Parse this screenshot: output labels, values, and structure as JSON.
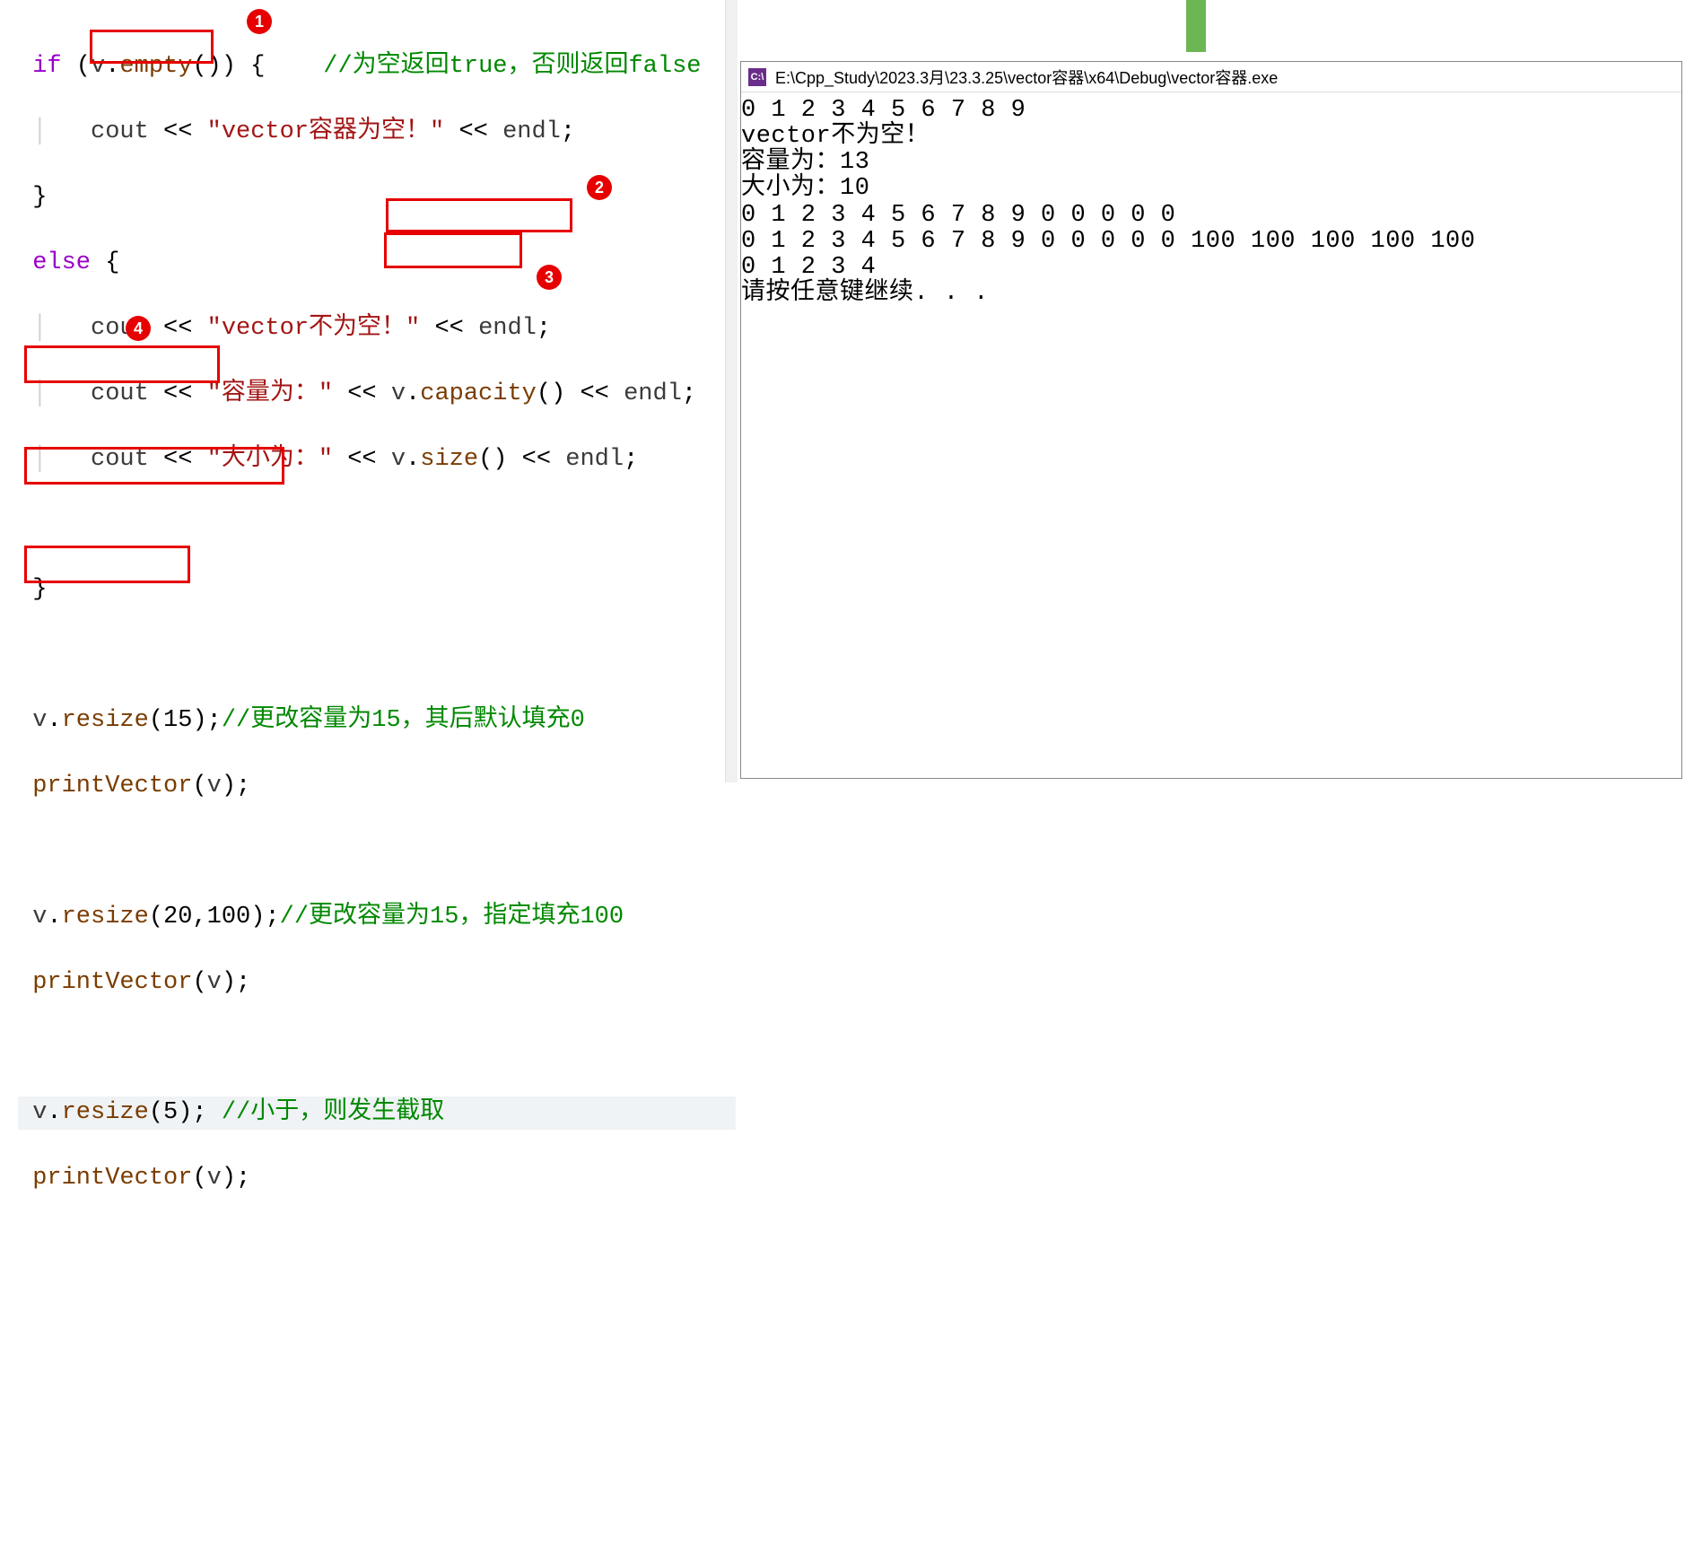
{
  "code": {
    "if": "if",
    "else": "else",
    "v": "v",
    "empty": "empty",
    "capacity": "capacity",
    "size": "size",
    "resize": "resize",
    "cout": "cout",
    "endl": "endl",
    "printVector": "printVector",
    "str_empty": "\"vector容器为空！\"",
    "str_notempty": "\"vector不为空！\"",
    "str_cap": "\"容量为：\"",
    "str_size": "\"大小为：\"",
    "cmt_empty": "//为空返回true，否则返回false",
    "cmt_r1": "//更改容量为15，其后默认填充0",
    "cmt_r2": "//更改容量为15，指定填充100",
    "cmt_r3": "//小于，则发生截取",
    "num15": "15",
    "num20": "20",
    "num100": "100",
    "num5": "5"
  },
  "badges": {
    "b1": "1",
    "b2": "2",
    "b3": "3",
    "b4": "4"
  },
  "console": {
    "title": "E:\\Cpp_Study\\2023.3月\\23.3.25\\vector容器\\x64\\Debug\\vector容器.exe",
    "icon": "C:\\",
    "lines": [
      "0 1 2 3 4 5 6 7 8 9",
      "vector不为空！",
      "容量为：13",
      "大小为：10",
      "0 1 2 3 4 5 6 7 8 9 0 0 0 0 0",
      "0 1 2 3 4 5 6 7 8 9 0 0 0 0 0 100 100 100 100 100",
      "0 1 2 3 4",
      "请按任意键继续. . ."
    ]
  }
}
